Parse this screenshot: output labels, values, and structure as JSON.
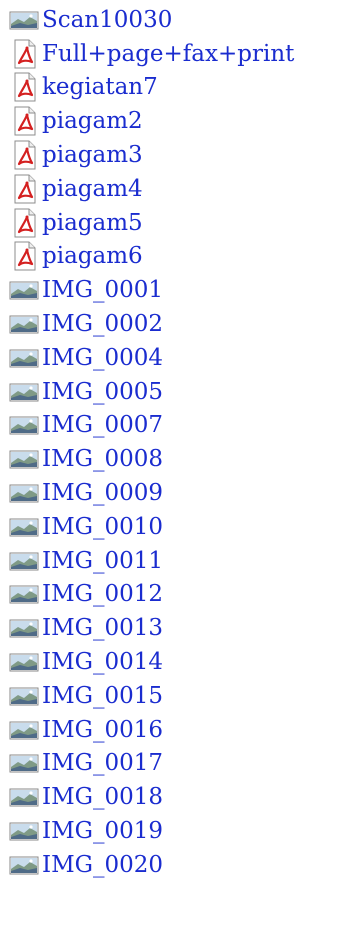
{
  "colors": {
    "link": "#1a2ccf",
    "background": "#ffffff"
  },
  "files": [
    {
      "name": "Scan10030",
      "icon": "image-file-icon"
    },
    {
      "name": "Full+page+fax+print",
      "icon": "pdf-file-icon"
    },
    {
      "name": "kegiatan7",
      "icon": "pdf-file-icon"
    },
    {
      "name": "piagam2",
      "icon": "pdf-file-icon"
    },
    {
      "name": "piagam3",
      "icon": "pdf-file-icon"
    },
    {
      "name": "piagam4",
      "icon": "pdf-file-icon"
    },
    {
      "name": "piagam5",
      "icon": "pdf-file-icon"
    },
    {
      "name": "piagam6",
      "icon": "pdf-file-icon"
    },
    {
      "name": "IMG_0001",
      "icon": "image-file-icon"
    },
    {
      "name": "IMG_0002",
      "icon": "image-file-icon"
    },
    {
      "name": "IMG_0004",
      "icon": "image-file-icon"
    },
    {
      "name": "IMG_0005",
      "icon": "image-file-icon"
    },
    {
      "name": "IMG_0007",
      "icon": "image-file-icon"
    },
    {
      "name": "IMG_0008",
      "icon": "image-file-icon"
    },
    {
      "name": "IMG_0009",
      "icon": "image-file-icon"
    },
    {
      "name": "IMG_0010",
      "icon": "image-file-icon"
    },
    {
      "name": "IMG_0011",
      "icon": "image-file-icon"
    },
    {
      "name": "IMG_0012",
      "icon": "image-file-icon"
    },
    {
      "name": "IMG_0013",
      "icon": "image-file-icon"
    },
    {
      "name": "IMG_0014",
      "icon": "image-file-icon"
    },
    {
      "name": "IMG_0015",
      "icon": "image-file-icon"
    },
    {
      "name": "IMG_0016",
      "icon": "image-file-icon"
    },
    {
      "name": "IMG_0017",
      "icon": "image-file-icon"
    },
    {
      "name": "IMG_0018",
      "icon": "image-file-icon"
    },
    {
      "name": "IMG_0019",
      "icon": "image-file-icon"
    },
    {
      "name": "IMG_0020",
      "icon": "image-file-icon"
    }
  ]
}
